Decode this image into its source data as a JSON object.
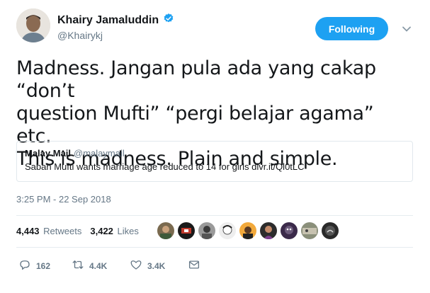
{
  "author": {
    "display_name": "Khairy Jamaluddin",
    "handle": "@Khairykj",
    "verified": true
  },
  "follow_button": {
    "label": "Following"
  },
  "tweet": {
    "lines": [
      "Madness. Jangan pula ada yang cakap “don’t",
      "question Mufti” “pergi belajar agama” etc.",
      "This is madness. Plain and simple."
    ]
  },
  "quote": {
    "name": "Malay Mail",
    "handle": "@malaymail",
    "text": "Sabah Mufti wants marriage age reduced to 14 for girls dlvr.it/Ql0tLC"
  },
  "timestamp": "3:25 PM - 22 Sep 2018",
  "stats": {
    "retweets_count": "4,443",
    "retweets_label": "Retweets",
    "likes_count": "3,422",
    "likes_label": "Likes"
  },
  "actions": {
    "reply_count": "162",
    "retweet_count": "4.4K",
    "like_count": "3.4K"
  },
  "colors": {
    "accent": "#1da1f2",
    "muted": "#657786",
    "text": "#14171a",
    "border": "#e1e8ed"
  }
}
